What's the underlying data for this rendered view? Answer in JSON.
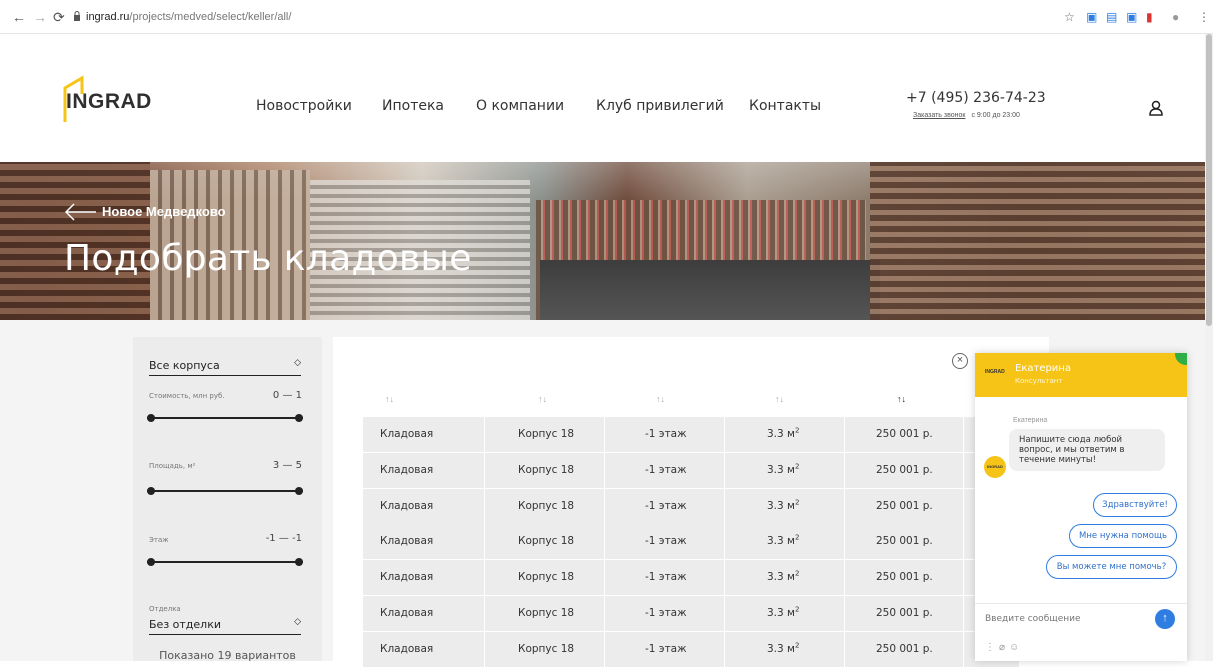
{
  "browser": {
    "url_host": "ingrad.ru",
    "url_path": "/projects/medved/select/keller/all/",
    "back_icon": "arrow-left-icon",
    "forward_icon": "arrow-right-icon",
    "reload_icon": "reload-icon"
  },
  "header": {
    "logo": "INGRAD",
    "nav": [
      "Новостройки",
      "Ипотека",
      "О компании",
      "Клуб привилегий",
      "Контакты"
    ],
    "phone": "+7 (495) 236-74-23",
    "callback_link": "Заказать звонок",
    "callback_hours": "с 9:00 до 23:00"
  },
  "hero": {
    "back_label": "Новое Медведково",
    "title": "Подобрать кладовые"
  },
  "filters": {
    "building_select": "Все корпуса",
    "price_label": "Стоимость, млн руб.",
    "price_value": "0 — 1",
    "area_label": "Площадь, м²",
    "area_value": "3 — 5",
    "floor_label": "Этаж",
    "floor_value": "-1 — -1",
    "finish_label": "Отделка",
    "finish_select": "Без отделки",
    "shown_text": "Показано 19 вариантов"
  },
  "table": {
    "rows": [
      {
        "type": "Кладовая",
        "building": "Корпус 18",
        "floor": "-1 этаж",
        "area": "3.3 м",
        "sup": "2",
        "price": "250 001 р."
      },
      {
        "type": "Кладовая",
        "building": "Корпус 18",
        "floor": "-1 этаж",
        "area": "3.3 м",
        "sup": "2",
        "price": "250 001 р."
      },
      {
        "type": "Кладовая",
        "building": "Корпус 18",
        "floor": "-1 этаж",
        "area": "3.3 м",
        "sup": "2",
        "price": "250 001 р."
      },
      {
        "type": "Кладовая",
        "building": "Корпус 18",
        "floor": "-1 этаж",
        "area": "3.3 м",
        "sup": "2",
        "price": "250 001 р."
      },
      {
        "type": "Кладовая",
        "building": "Корпус 18",
        "floor": "-1 этаж",
        "area": "3.3 м",
        "sup": "2",
        "price": "250 001 р."
      },
      {
        "type": "Кладовая",
        "building": "Корпус 18",
        "floor": "-1 этаж",
        "area": "3.3 м",
        "sup": "2",
        "price": "250 001 р."
      },
      {
        "type": "Кладовая",
        "building": "Корпус 18",
        "floor": "-1 этаж",
        "area": "3.3 м",
        "sup": "2",
        "price": "250 001 р."
      }
    ]
  },
  "chat": {
    "header_logo": "INGRAD",
    "agent_name": "Екатерина",
    "agent_role": "Консультант",
    "message_author": "Екатерина",
    "message": "Напишите сюда любой вопрос, и мы ответим в течение минуты!",
    "avatar_text": "INGRAD",
    "quick_replies": [
      "Здравствуйте!",
      "Мне нужна помощь",
      "Вы можете мне помочь?"
    ],
    "input_placeholder": "Введите сообщение",
    "close_icon": "close-icon",
    "send_icon": "send-arrow-icon"
  },
  "colors": {
    "accent_yellow": "#f6c417",
    "chat_blue": "#2f7de1",
    "status_green": "#2fae45"
  }
}
